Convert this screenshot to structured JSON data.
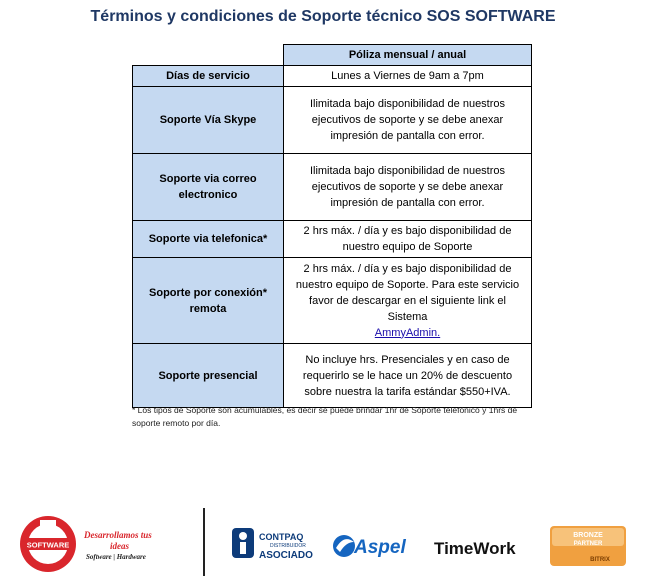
{
  "title": "Términos y condiciones de Soporte técnico SOS SOFTWARE",
  "table": {
    "header": "Póliza mensual / anual",
    "rows": [
      {
        "label": "Días de servicio",
        "value": "Lunes a Viernes de 9am a 7pm"
      },
      {
        "label": "Soporte Vía Skype",
        "value": "Ilimitada bajo disponibilidad de nuestros ejecutivos de soporte y se debe anexar impresión de pantalla con error."
      },
      {
        "label": "Soporte via correo electronico",
        "value": "Ilimitada bajo disponibilidad de nuestros ejecutivos de soporte y se debe anexar impresión de pantalla con error."
      },
      {
        "label": "Soporte via telefonica*",
        "value": "2 hrs máx. / día y es bajo disponibilidad de nuestro equipo de Soporte"
      },
      {
        "label": "Soporte por conexión* remota",
        "value": "2 hrs máx. / día y es bajo disponibilidad de nuestro equipo de Soporte. Para este servicio favor de descargar en el siguiente link el Sistema",
        "link": "AmmyAdmin."
      },
      {
        "label": "Soporte presencial",
        "value": "No incluye hrs. Presenciales y en caso de requerirlo se le hace un 20% de descuento sobre nuestra la tarifa estándar $550+IVA."
      }
    ]
  },
  "footnote": "* Los tipos de Soporte son acumulables, es decir se puede brindar 1hr de Soporte telefónico y 1hrs de soporte remoto por día.",
  "logos": {
    "sos": {
      "badge": "SOFTWARE",
      "tagline1": "Desarrollamos tus",
      "tagline2": "ideas",
      "tagline3": "Software | Hardware"
    },
    "contpaqi": {
      "line1": "CONTPAQ",
      "line2": "DISTRIBUIDOR",
      "line3": "ASOCIADO"
    },
    "aspel": "Aspel",
    "timework": "TimeWork",
    "bitrix": {
      "line1": "BRONZE",
      "line2": "PARTNER",
      "line3": "BITRIX"
    }
  },
  "colors": {
    "title": "#1f3864",
    "header_fill": "#c5d9f1",
    "link": "#1a0dab",
    "sos_red": "#d9262c",
    "aspel_blue": "#1565c0",
    "bitrix_orange": "#f0a040"
  }
}
